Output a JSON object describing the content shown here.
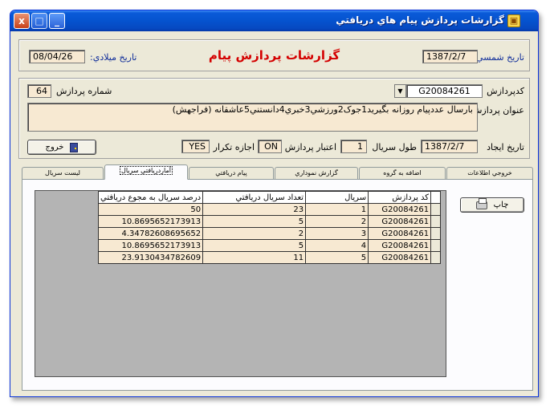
{
  "window": {
    "title": "گزارشات پردازش پيام هاي دريافتي",
    "buttons": {
      "minimize": "_",
      "maximize": "□",
      "close": "x"
    }
  },
  "header": {
    "main_title": "گزارشات پردازش پيام",
    "shamsi_label": "تاريخ شمسي:",
    "shamsi_value": "1387/2/7",
    "miladi_label": "تاريخ ميلادي:",
    "miladi_value": "08/04/26"
  },
  "details": {
    "code_label": "كدپردازش",
    "code_value": "G20084261",
    "count_label": "شماره پردازش",
    "count_value": "64",
    "subject_label": "عنوان پردازش",
    "subject_value": "بارسال عددپيام روزانه بگيريد1جوک2ورزشي3خبري4دانستني5عاشقانه (فراجهش)",
    "created_label": "تاريخ ايجاد",
    "created_value": "1387/2/7",
    "serial_length_label": "طول سريال",
    "serial_length_value": "1",
    "validity_label": "اعتبار پردازش",
    "validity_value": "ON",
    "repeat_label": "اجازه تكرار",
    "repeat_value": "YES",
    "exit_label": "خروج"
  },
  "tabs": [
    {
      "label": "خروجي اطلاعات"
    },
    {
      "label": "اضافه به گروه"
    },
    {
      "label": "گزارش نموداري"
    },
    {
      "label": "پيام دريافتي"
    },
    {
      "label": "آماردريافتي سريال"
    },
    {
      "label": "ليست سريال"
    }
  ],
  "active_tab": "آماردريافتي سريال",
  "grid": {
    "columns": [
      "كد پردازش",
      "سريال",
      "تعداد سريال دريافتي",
      "درصد سريال به مجوع دريافتي"
    ],
    "rows": [
      [
        "G20084261",
        "1",
        "23",
        "50"
      ],
      [
        "G20084261",
        "2",
        "5",
        "10.8695652173913"
      ],
      [
        "G20084261",
        "3",
        "2",
        "4.34782608695652"
      ],
      [
        "G20084261",
        "4",
        "5",
        "10.8695652173913"
      ],
      [
        "G20084261",
        "5",
        "11",
        "23.9130434782609"
      ]
    ]
  },
  "print_label": "چاپ",
  "colors": {
    "title_red": "#d40000",
    "label_blue": "#0f2d9a",
    "field_bg": "#f7e9d2",
    "window_bg": "#ece9d8",
    "titlebar": "#0553cf"
  }
}
